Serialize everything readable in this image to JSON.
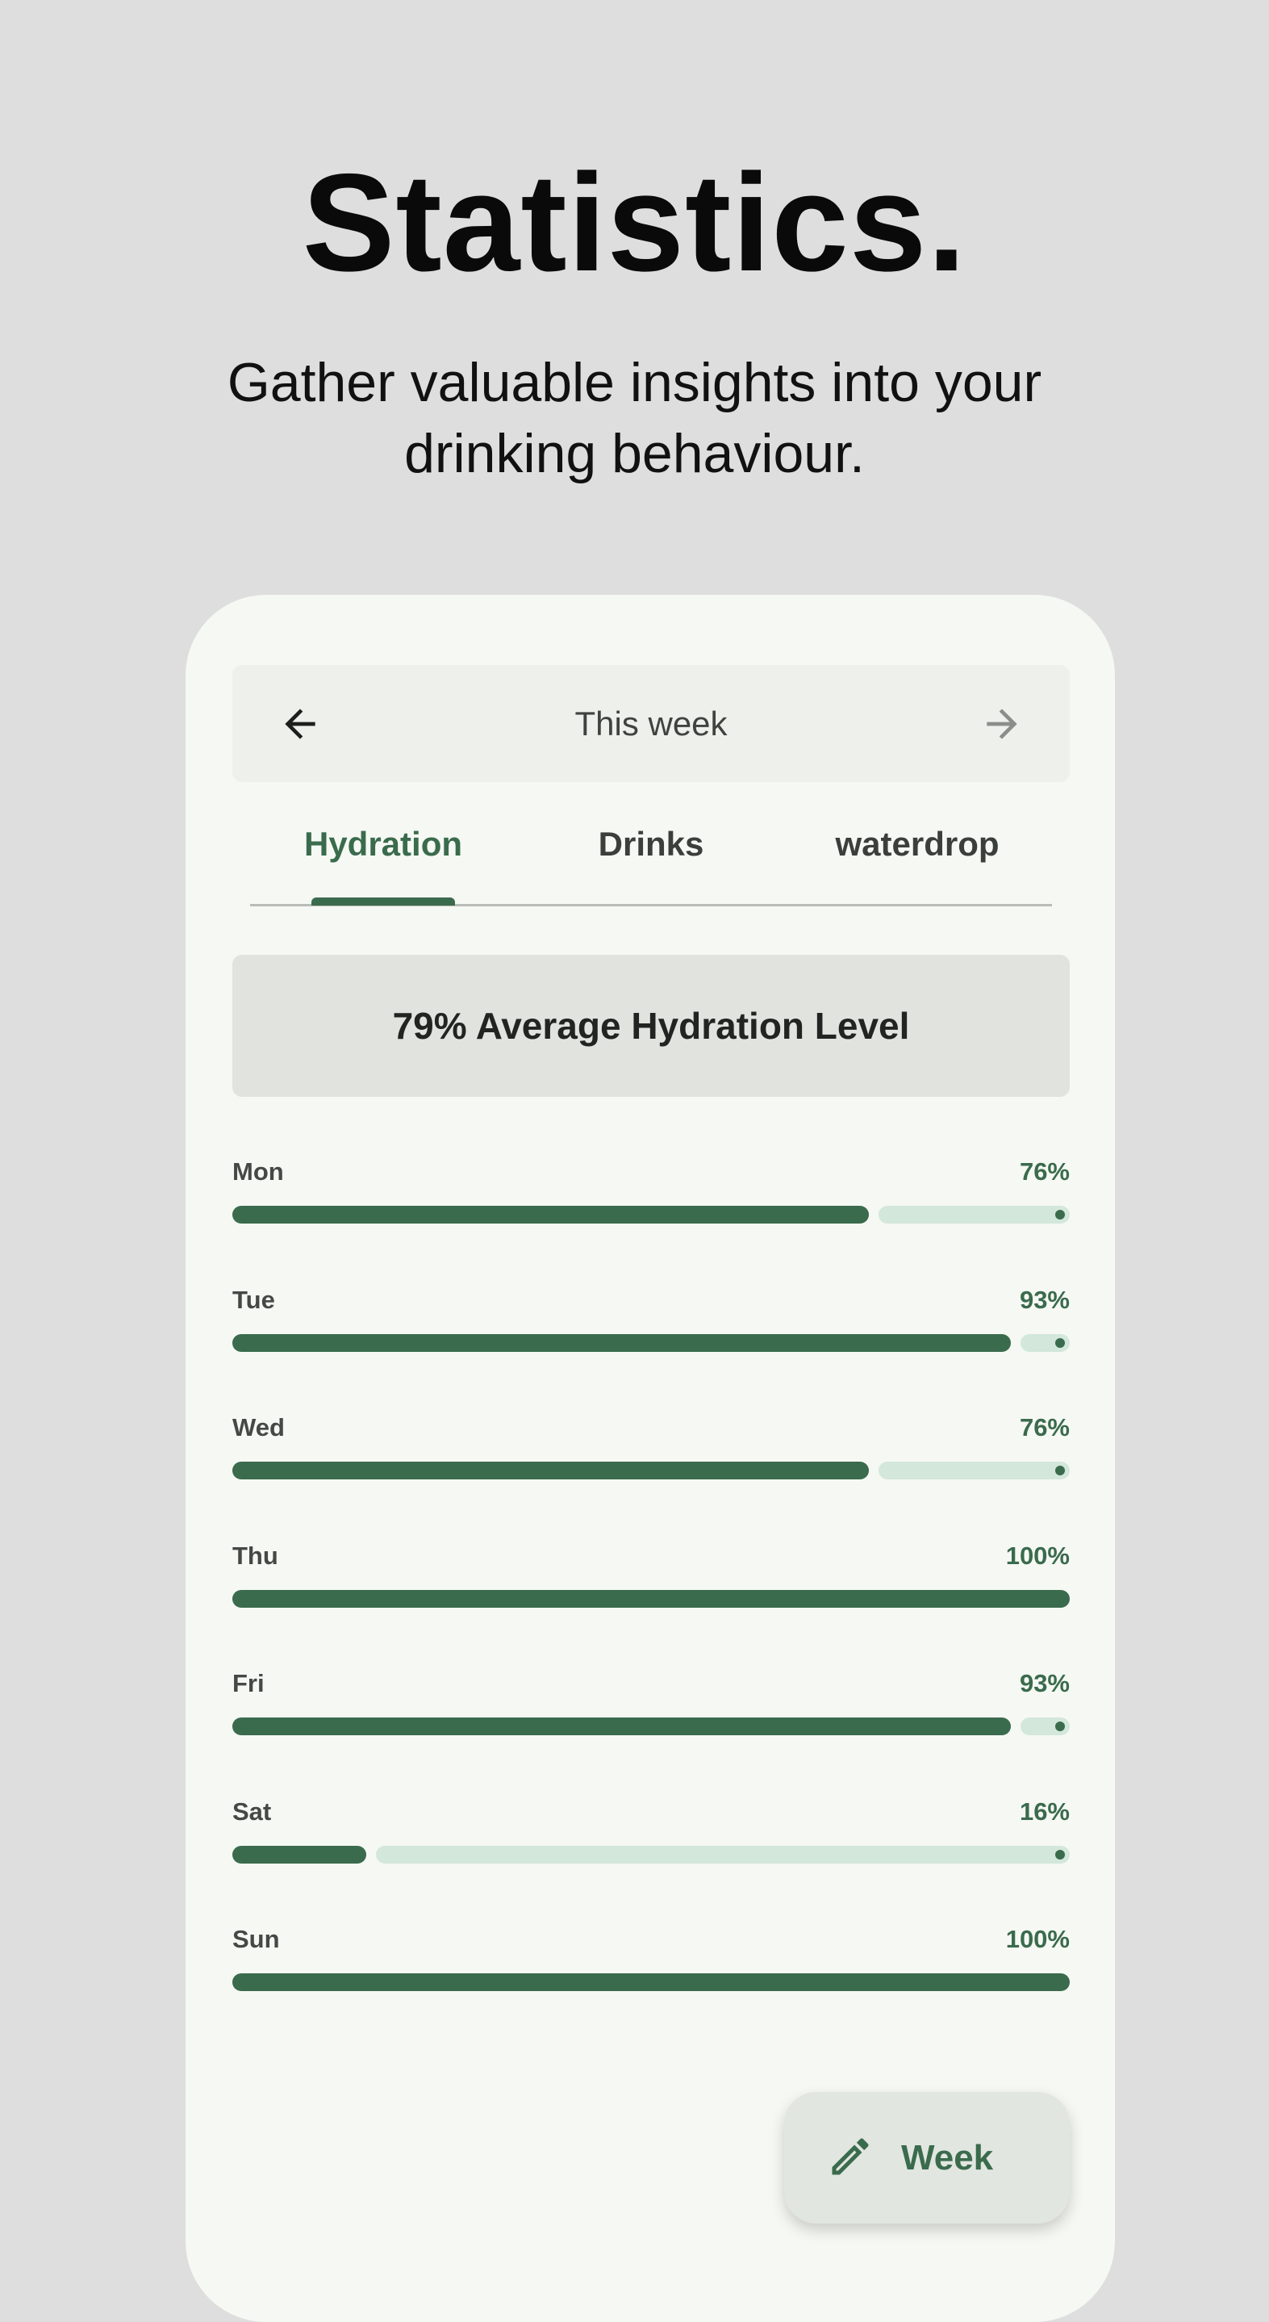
{
  "hero": {
    "title": "Statistics.",
    "subtitle_line1": "Gather valuable insights into your",
    "subtitle_line2": "drinking behaviour."
  },
  "date_nav": {
    "period": "This week",
    "prev_icon": "arrow-left-icon",
    "next_icon": "arrow-right-icon"
  },
  "tabs": [
    {
      "label": "Hydration",
      "selected": true
    },
    {
      "label": "Drinks",
      "selected": false
    },
    {
      "label": "waterdrop",
      "selected": false
    }
  ],
  "summary": {
    "text": "79% Average Hydration Level"
  },
  "days": [
    {
      "name": "Mon",
      "value_label": "76%",
      "percent": 76
    },
    {
      "name": "Tue",
      "value_label": "93%",
      "percent": 93
    },
    {
      "name": "Wed",
      "value_label": "76%",
      "percent": 76
    },
    {
      "name": "Thu",
      "value_label": "100%",
      "percent": 100
    },
    {
      "name": "Fri",
      "value_label": "93%",
      "percent": 93
    },
    {
      "name": "Sat",
      "value_label": "16%",
      "percent": 16
    },
    {
      "name": "Sun",
      "value_label": "100%",
      "percent": 100
    }
  ],
  "fab": {
    "label": "Week",
    "icon": "pencil-icon"
  },
  "colors": {
    "accent": "#3a6b4d",
    "track": "#d3e7db",
    "background": "#dedede",
    "card": "#f6f8f3"
  }
}
